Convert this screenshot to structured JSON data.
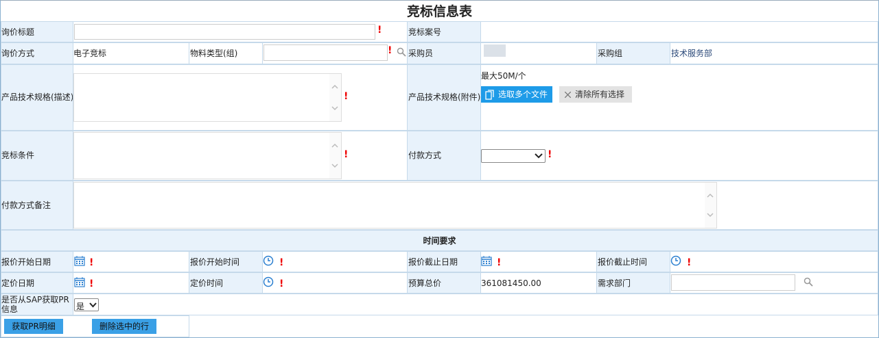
{
  "form": {
    "title": "竞标信息表",
    "inquiry_title_label": "询价标题",
    "bid_case_no_label": "竞标案号",
    "inquiry_method_label": "询价方式",
    "inquiry_method_value": "电子竞标",
    "material_type_label": "物料类型(组)",
    "buyer_label": "采购员",
    "purchase_group_label": "采购组",
    "purchase_group_value": "技术服务部",
    "spec_desc_label": "产品技术规格(描述)",
    "spec_attach_label": "产品技术规格(附件)",
    "attach_max_note": "最大50M/个",
    "select_files_label": "选取多个文件",
    "clear_selection_label": "清除所有选择",
    "bid_conditions_label": "竞标条件",
    "payment_method_label": "付款方式",
    "payment_method_value": "",
    "payment_note_label": "付款方式备注",
    "time_section_label": "时间要求",
    "quote_start_date_label": "报价开始日期",
    "quote_start_time_label": "报价开始时间",
    "quote_end_date_label": "报价截止日期",
    "quote_end_time_label": "报价截止时间",
    "pricing_date_label": "定价日期",
    "pricing_time_label": "定价时间",
    "budget_total_label": "预算总价",
    "budget_total_value": "361081450.00",
    "demand_dept_label": "需求部门",
    "sap_pr_label": "是否从SAP获取PR信息",
    "sap_pr_value": "是",
    "get_pr_detail_label": "获取PR明细",
    "delete_rows_label": "删除选中的行",
    "required_mark": "!"
  },
  "colors": {
    "label_bg": "#e8f2fb",
    "border": "#c5d9ea",
    "required": "#e00000",
    "primary_button": "#1e9be8",
    "icon_blue": "#2a7fd0"
  },
  "icons": [
    "search-icon",
    "calendar-icon",
    "clock-icon",
    "file-icon",
    "close-icon",
    "chevron-down-icon",
    "chevron-up-icon"
  ]
}
